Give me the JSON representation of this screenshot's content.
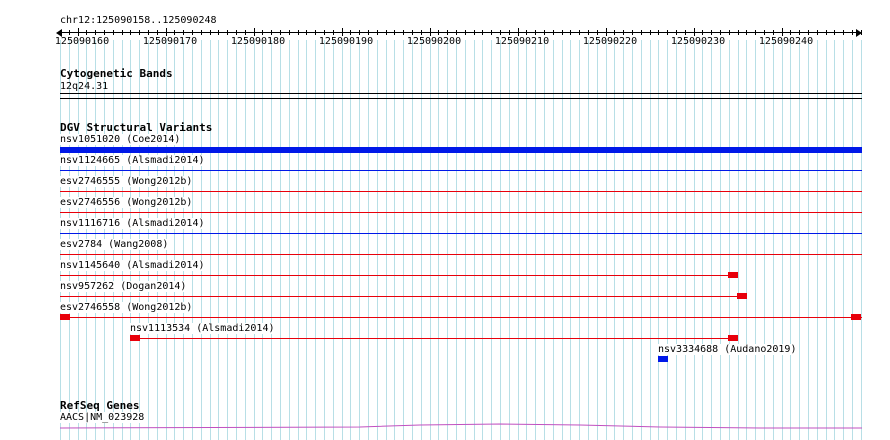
{
  "colors": {
    "grid": "#b8dfe6",
    "red": "#e8000b",
    "blue": "#0018e8",
    "refseq": "#c050c0",
    "text": "#000000"
  },
  "ruler": {
    "title": "chr12:125090158..125090248",
    "ticks": [
      "125090160",
      "125090170",
      "125090180",
      "125090190",
      "125090200",
      "125090210",
      "125090220",
      "125090230",
      "125090240"
    ]
  },
  "cytoband": {
    "title": "Cytogenetic Bands",
    "band": "12q24.31"
  },
  "dgv": {
    "title": "DGV Structural Variants",
    "variants": [
      {
        "label": "nsv1051020 (Coe2014)",
        "color": "blue",
        "style": "thick"
      },
      {
        "label": "nsv1124665 (Alsmadi2014)",
        "color": "blue",
        "style": "thin"
      },
      {
        "label": "esv2746555 (Wong2012b)",
        "color": "red",
        "style": "thin"
      },
      {
        "label": "esv2746556 (Wong2012b)",
        "color": "red",
        "style": "thin"
      },
      {
        "label": "nsv1116716 (Alsmadi2014)",
        "color": "blue",
        "style": "thin"
      },
      {
        "label": "esv2784 (Wang2008)",
        "color": "red",
        "style": "thin"
      },
      {
        "label": "nsv1145640 (Alsmadi2014)",
        "color": "red",
        "style": "thin"
      },
      {
        "label": "nsv957262 (Dogan2014)",
        "color": "red",
        "style": "thin"
      },
      {
        "label": "esv2746558 (Wong2012b)",
        "color": "red",
        "style": "thin"
      },
      {
        "label": "nsv1113534 (Alsmadi2014)",
        "color": "red",
        "style": "thin"
      },
      {
        "label": "nsv3334688 (Audano2019)",
        "color": "blue",
        "style": "block"
      }
    ]
  },
  "refseq": {
    "title": "RefSeq Genes",
    "gene": "AACS|NM_023928"
  }
}
